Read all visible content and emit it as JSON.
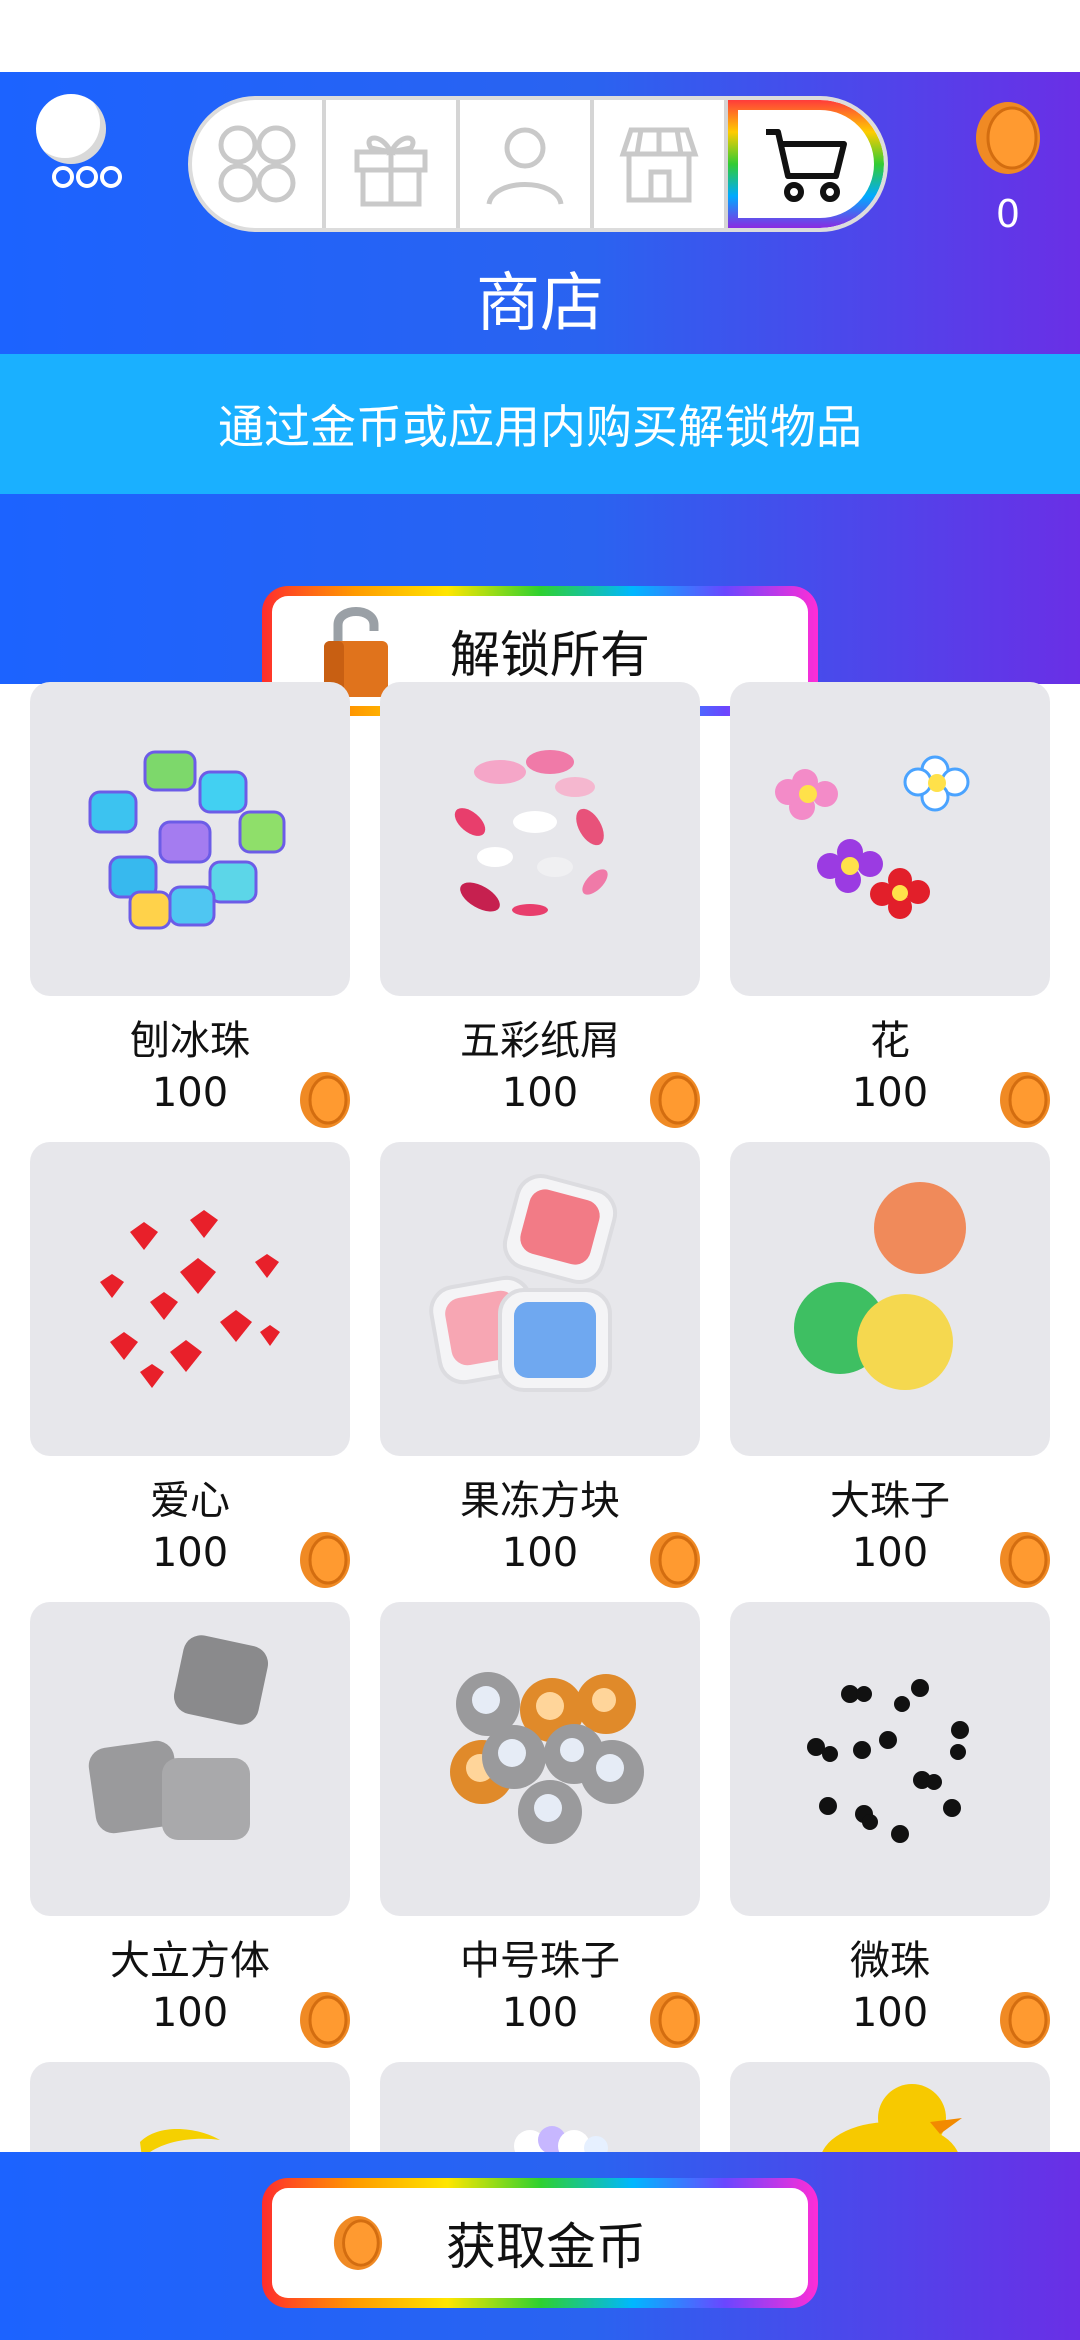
{
  "header": {
    "title": "商店",
    "coin_count": "0",
    "tabs": [
      {
        "name": "tab-collections",
        "icon": "grid-icon"
      },
      {
        "name": "tab-gifts",
        "icon": "gift-icon"
      },
      {
        "name": "tab-profile",
        "icon": "user-icon"
      },
      {
        "name": "tab-store",
        "icon": "storefront-icon"
      },
      {
        "name": "tab-shop",
        "icon": "cart-icon",
        "active": true
      }
    ]
  },
  "banner": {
    "text": "通过金币或应用内购买解锁物品"
  },
  "unlock_all": {
    "label": "解锁所有",
    "icon": "lock-icon"
  },
  "items": [
    {
      "name": "刨冰珠",
      "price": "100"
    },
    {
      "name": "五彩纸屑",
      "price": "100"
    },
    {
      "name": "花",
      "price": "100"
    },
    {
      "name": "爱心",
      "price": "100"
    },
    {
      "name": "果冻方块",
      "price": "100"
    },
    {
      "name": "大珠子",
      "price": "100"
    },
    {
      "name": "大立方体",
      "price": "100"
    },
    {
      "name": "中号珠子",
      "price": "100"
    },
    {
      "name": "微珠",
      "price": "100"
    }
  ],
  "bottom": {
    "get_coins_label": "获取金币",
    "icon": "coin-icon"
  },
  "colors": {
    "header_start": "#1c63ff",
    "header_end": "#6a2fe6",
    "banner": "#1ab0ff",
    "coin": "#f08a24",
    "card_bg": "#e7e7eb"
  }
}
